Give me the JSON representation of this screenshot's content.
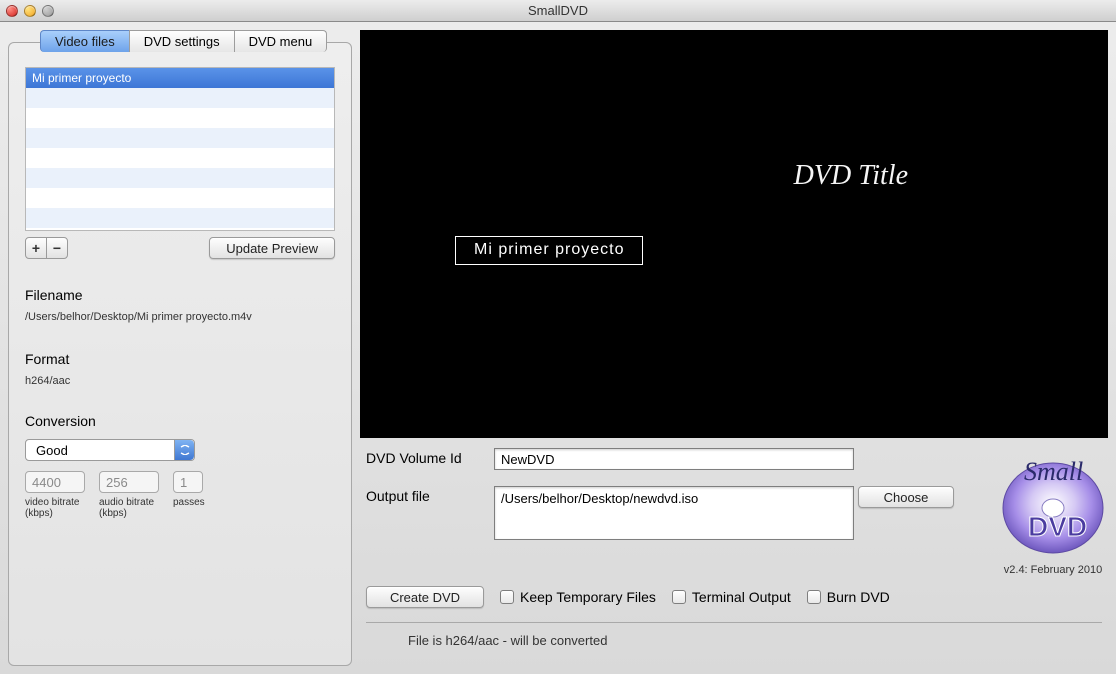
{
  "window_title": "SmallDVD",
  "tabs": {
    "video_files": "Video files",
    "dvd_settings": "DVD settings",
    "dvd_menu": "DVD menu"
  },
  "file_list": {
    "selected": "Mi primer proyecto"
  },
  "add_btn": "+",
  "remove_btn": "−",
  "update_preview": "Update Preview",
  "filename_label": "Filename",
  "filename_value": "/Users/belhor/Desktop/Mi primer proyecto.m4v",
  "format_label": "Format",
  "format_value": "h264/aac",
  "conversion_label": "Conversion",
  "conversion_value": "Good",
  "video_bitrate": "4400",
  "audio_bitrate": "256",
  "passes": "1",
  "video_bitrate_lbl": "video bitrate (kbps)",
  "audio_bitrate_lbl": "audio bitrate (kbps)",
  "passes_lbl": "passes",
  "preview_title": "DVD Title",
  "preview_menu_item": "Mi primer proyecto",
  "volume_id_label": "DVD Volume Id",
  "volume_id_value": "NewDVD",
  "output_label": "Output file",
  "output_value": "/Users/belhor/Desktop/newdvd.iso",
  "choose_btn": "Choose",
  "create_btn": "Create DVD",
  "keep_temp": "Keep Temporary Files",
  "terminal_out": "Terminal Output",
  "burn_dvd": "Burn DVD",
  "version": "v2.4: February 2010",
  "status": "File is h264/aac - will be converted",
  "logo_text_small": "Small",
  "logo_text_dvd": "DVD"
}
